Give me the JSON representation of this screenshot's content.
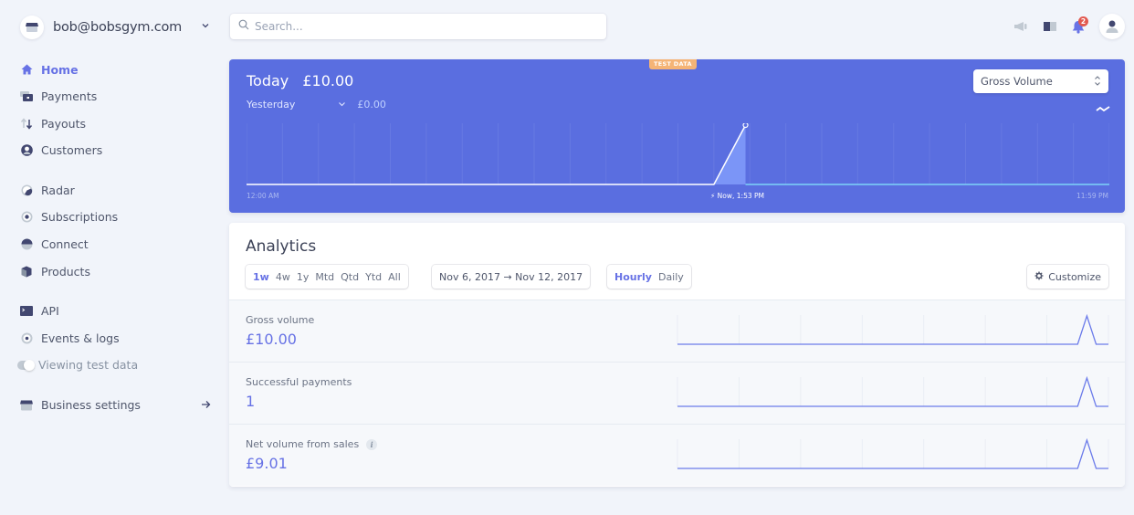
{
  "account": {
    "name": "bob@bobsgym.com"
  },
  "search": {
    "placeholder": "Search..."
  },
  "notifications": {
    "count": "2"
  },
  "sidebar": {
    "items": [
      {
        "label": "Home",
        "icon": "home-icon",
        "active": true
      },
      {
        "label": "Payments",
        "icon": "payments-icon"
      },
      {
        "label": "Payouts",
        "icon": "payouts-icon"
      },
      {
        "label": "Customers",
        "icon": "customers-icon"
      },
      {
        "label": "Radar",
        "icon": "radar-icon"
      },
      {
        "label": "Subscriptions",
        "icon": "subscriptions-icon"
      },
      {
        "label": "Connect",
        "icon": "connect-icon"
      },
      {
        "label": "Products",
        "icon": "products-icon"
      },
      {
        "label": "API",
        "icon": "api-icon"
      },
      {
        "label": "Events & logs",
        "icon": "events-icon"
      }
    ],
    "test_toggle": {
      "label": "Viewing test data",
      "on": true
    },
    "business_settings": {
      "label": "Business settings"
    }
  },
  "hero": {
    "badge": "TEST DATA",
    "title": "Today",
    "amount": "£10.00",
    "compare_label": "Yesterday",
    "compare_amount": "£0.00",
    "metric_select": "Gross Volume",
    "axis_start": "12:00 AM",
    "axis_now": "Now, 1:53 PM",
    "axis_end": "11:59 PM",
    "colors": {
      "background": "#5a6ee0",
      "today_line": "#ffffff",
      "future_line": "#7dd3f7",
      "fill": "#7b95f7"
    }
  },
  "chart_data": [
    {
      "type": "line",
      "title": "Today",
      "x_range": [
        "12:00 AM",
        "11:59 PM"
      ],
      "x_hours": [
        0,
        12,
        13,
        13.88
      ],
      "today": [
        0,
        0,
        0,
        10
      ],
      "yesterday": "flat £0.00",
      "now": "1:53 PM",
      "grid": true
    },
    {
      "type": "line",
      "name": "Gross volume",
      "x_days": [
        0,
        1,
        2,
        3,
        4,
        5,
        6,
        6.5,
        6.65,
        6.8,
        7
      ],
      "values": [
        0,
        0,
        0,
        0,
        0,
        0,
        0,
        0,
        10,
        0,
        0
      ]
    },
    {
      "type": "line",
      "name": "Successful payments",
      "x_days": [
        0,
        1,
        2,
        3,
        4,
        5,
        6,
        6.5,
        6.65,
        6.8,
        7
      ],
      "values": [
        0,
        0,
        0,
        0,
        0,
        0,
        0,
        0,
        1,
        0,
        0
      ]
    },
    {
      "type": "line",
      "name": "Net volume from sales",
      "x_days": [
        0,
        1,
        2,
        3,
        4,
        5,
        6,
        6.5,
        6.65,
        6.8,
        7
      ],
      "values": [
        0,
        0,
        0,
        0,
        0,
        0,
        0,
        0,
        9.01,
        0,
        0
      ]
    }
  ],
  "analytics": {
    "title": "Analytics",
    "ranges": [
      "1w",
      "4w",
      "1y",
      "Mtd",
      "Qtd",
      "Ytd",
      "All"
    ],
    "selected_range": "1w",
    "date_range": "Nov 6, 2017 → Nov 12, 2017",
    "granularity": [
      "Hourly",
      "Daily"
    ],
    "selected_granularity": "Hourly",
    "customize_label": "Customize",
    "rows": [
      {
        "label": "Gross volume",
        "value": "£10.00"
      },
      {
        "label": "Successful payments",
        "value": "1"
      },
      {
        "label": "Net volume from sales",
        "value": "£9.01",
        "info": true
      }
    ],
    "spark_color": "#6b7bea"
  }
}
